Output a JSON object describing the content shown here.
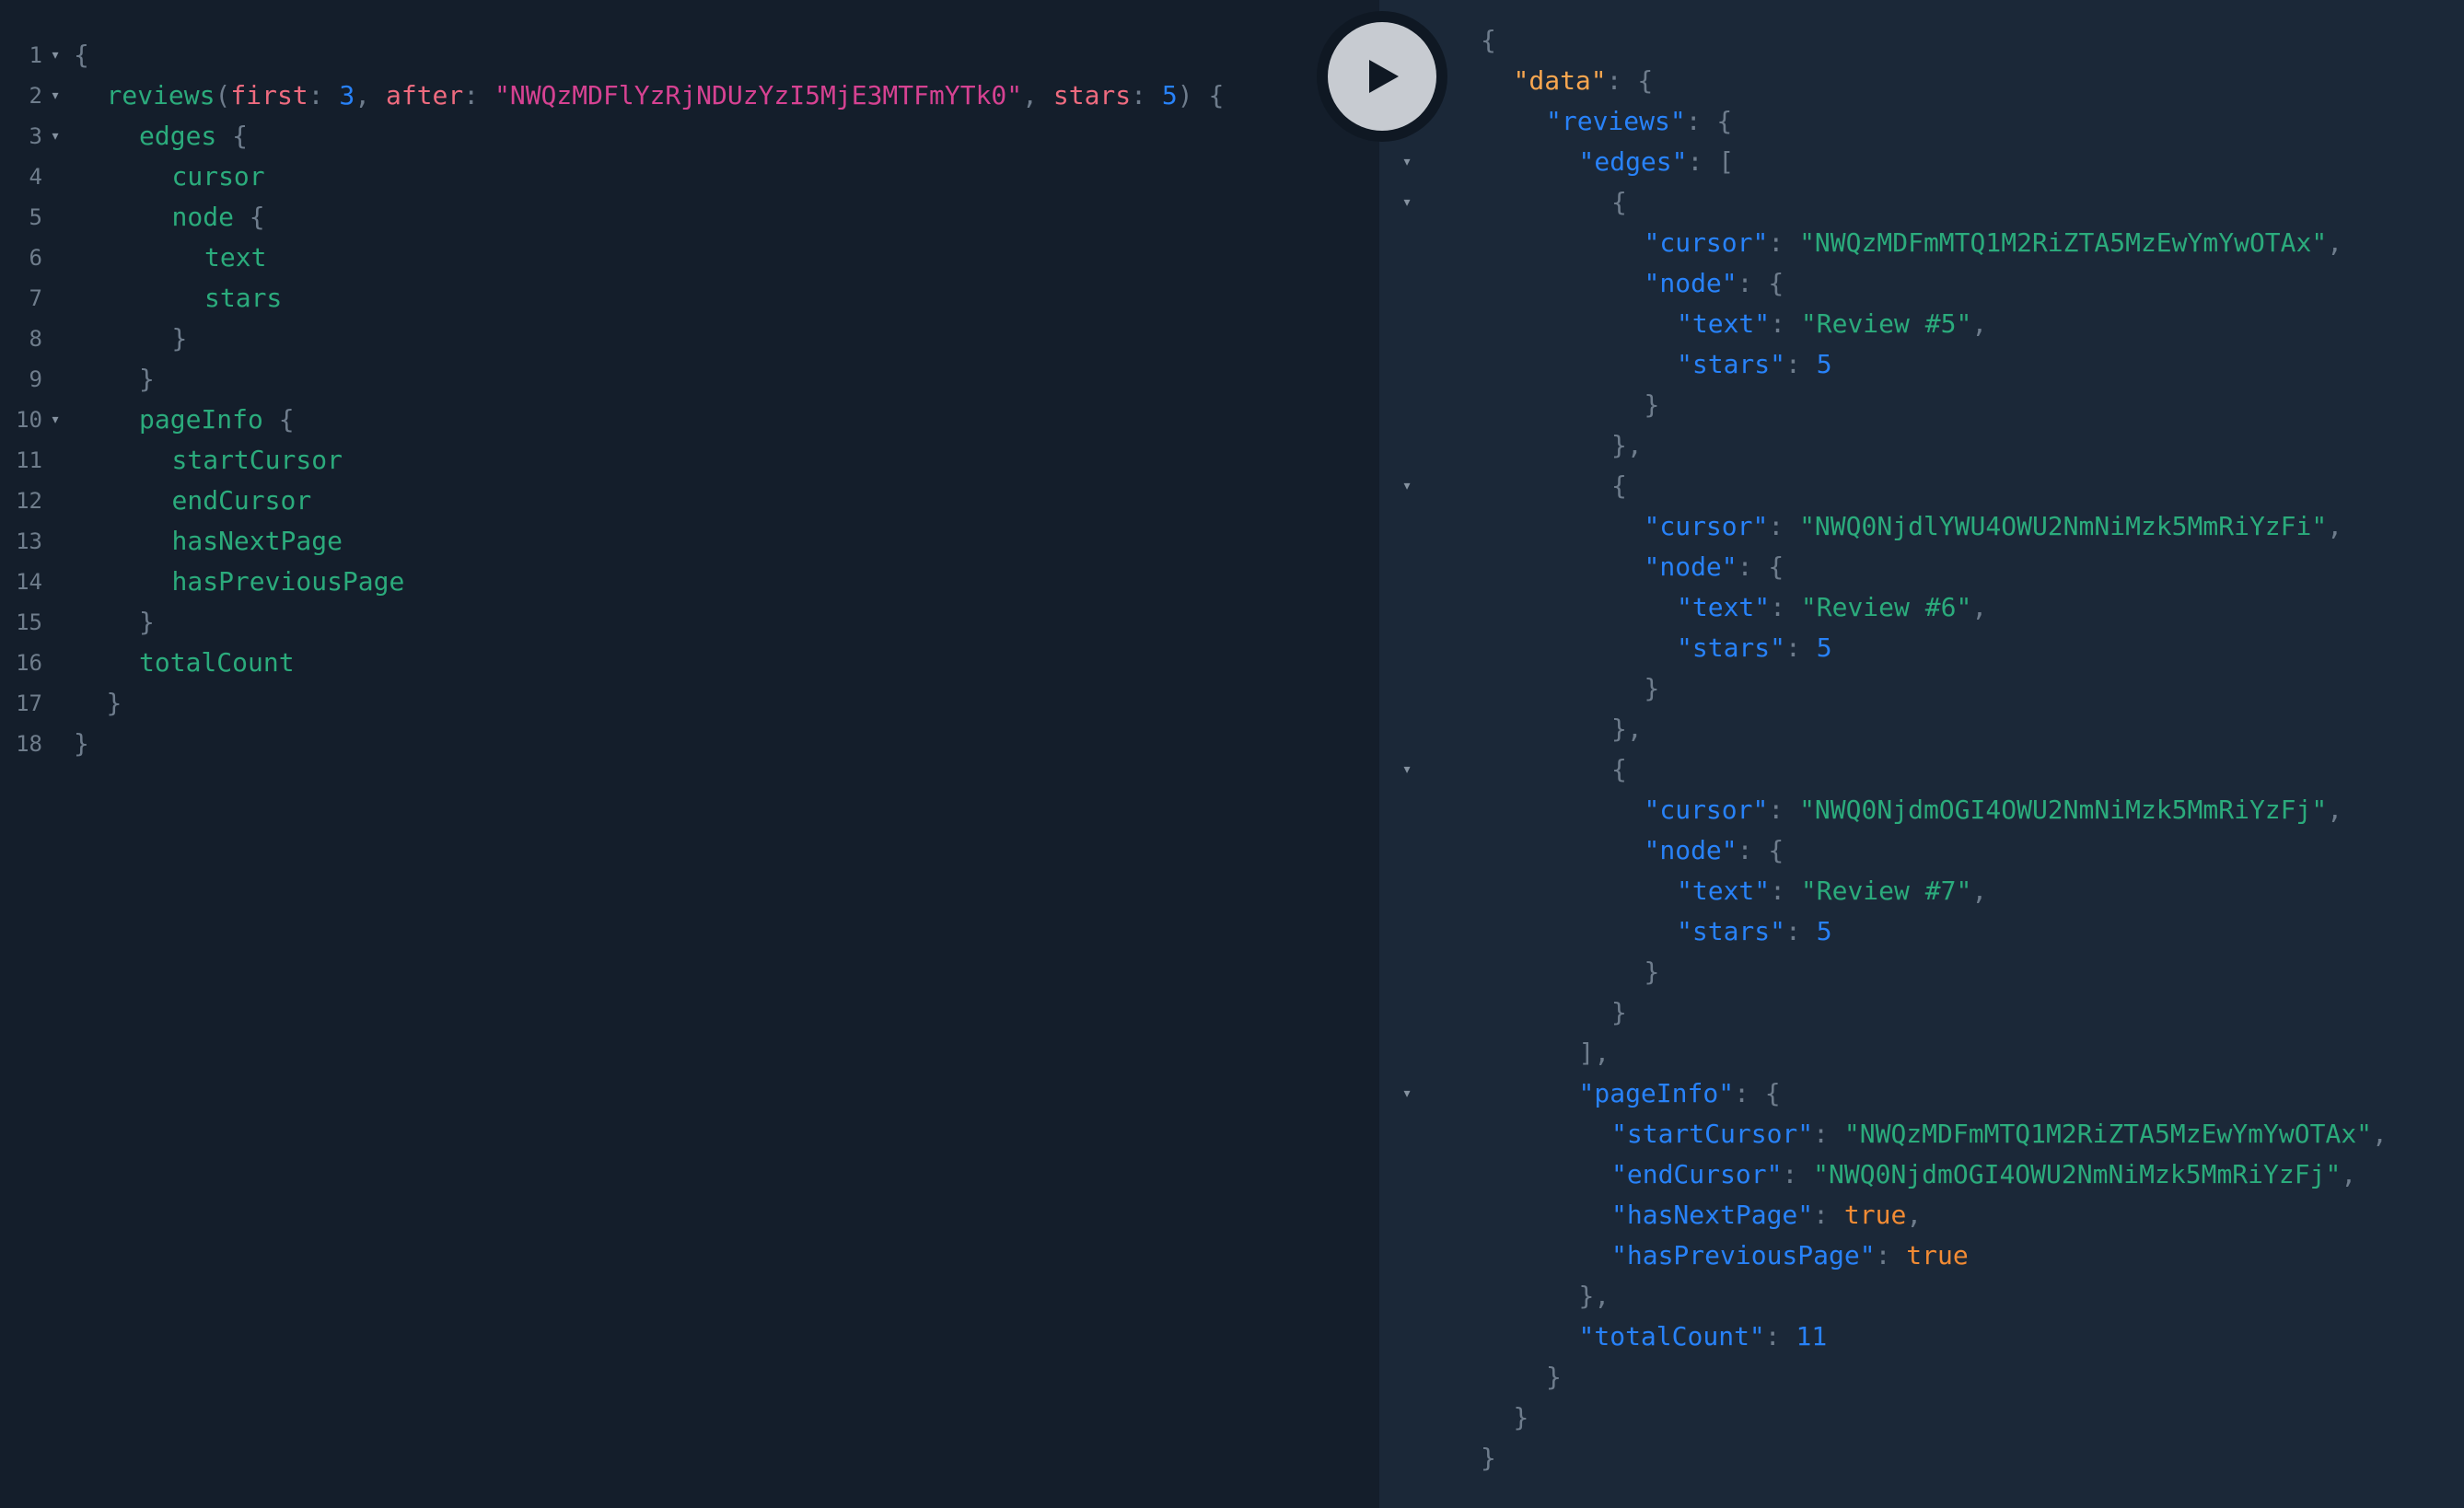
{
  "query_editor": {
    "lines": [
      {
        "n": "1",
        "fold": true,
        "indent": 0,
        "tokens": [
          {
            "c": "t-punct",
            "t": "{"
          }
        ]
      },
      {
        "n": "2",
        "fold": true,
        "indent": 1,
        "tokens": [
          {
            "c": "t-field",
            "t": "reviews"
          },
          {
            "c": "t-punct",
            "t": "("
          },
          {
            "c": "t-arg",
            "t": "first"
          },
          {
            "c": "t-punct",
            "t": ": "
          },
          {
            "c": "t-num",
            "t": "3"
          },
          {
            "c": "t-punct",
            "t": ", "
          },
          {
            "c": "t-arg",
            "t": "after"
          },
          {
            "c": "t-punct",
            "t": ": "
          },
          {
            "c": "t-str",
            "t": "\"NWQzMDFlYzRjNDUzYzI5MjE3MTFmYTk0\""
          },
          {
            "c": "t-punct",
            "t": ", "
          },
          {
            "c": "t-arg",
            "t": "stars"
          },
          {
            "c": "t-punct",
            "t": ": "
          },
          {
            "c": "t-num",
            "t": "5"
          },
          {
            "c": "t-punct",
            "t": ") {"
          }
        ]
      },
      {
        "n": "3",
        "fold": true,
        "indent": 2,
        "tokens": [
          {
            "c": "t-field",
            "t": "edges"
          },
          {
            "c": "t-punct",
            "t": " {"
          }
        ]
      },
      {
        "n": "4",
        "fold": false,
        "indent": 3,
        "tokens": [
          {
            "c": "t-field",
            "t": "cursor"
          }
        ]
      },
      {
        "n": "5",
        "fold": false,
        "indent": 3,
        "tokens": [
          {
            "c": "t-field",
            "t": "node"
          },
          {
            "c": "t-punct",
            "t": " {"
          }
        ]
      },
      {
        "n": "6",
        "fold": false,
        "indent": 4,
        "tokens": [
          {
            "c": "t-field",
            "t": "text"
          }
        ]
      },
      {
        "n": "7",
        "fold": false,
        "indent": 4,
        "tokens": [
          {
            "c": "t-field",
            "t": "stars"
          }
        ]
      },
      {
        "n": "8",
        "fold": false,
        "indent": 3,
        "tokens": [
          {
            "c": "t-punct",
            "t": "}"
          }
        ]
      },
      {
        "n": "9",
        "fold": false,
        "indent": 2,
        "tokens": [
          {
            "c": "t-punct",
            "t": "}"
          }
        ]
      },
      {
        "n": "10",
        "fold": true,
        "indent": 2,
        "tokens": [
          {
            "c": "t-field",
            "t": "pageInfo"
          },
          {
            "c": "t-punct",
            "t": " {"
          }
        ]
      },
      {
        "n": "11",
        "fold": false,
        "indent": 3,
        "tokens": [
          {
            "c": "t-field",
            "t": "startCursor"
          }
        ]
      },
      {
        "n": "12",
        "fold": false,
        "indent": 3,
        "tokens": [
          {
            "c": "t-field",
            "t": "endCursor"
          }
        ]
      },
      {
        "n": "13",
        "fold": false,
        "indent": 3,
        "tokens": [
          {
            "c": "t-field",
            "t": "hasNextPage"
          }
        ]
      },
      {
        "n": "14",
        "fold": false,
        "indent": 3,
        "tokens": [
          {
            "c": "t-field",
            "t": "hasPreviousPage"
          }
        ]
      },
      {
        "n": "15",
        "fold": false,
        "indent": 2,
        "tokens": [
          {
            "c": "t-punct",
            "t": "}"
          }
        ]
      },
      {
        "n": "16",
        "fold": false,
        "indent": 2,
        "tokens": [
          {
            "c": "t-field",
            "t": "totalCount"
          }
        ]
      },
      {
        "n": "17",
        "fold": false,
        "indent": 1,
        "tokens": [
          {
            "c": "t-punct",
            "t": "}"
          }
        ]
      },
      {
        "n": "18",
        "fold": false,
        "indent": 0,
        "tokens": [
          {
            "c": "t-punct",
            "t": "}"
          }
        ]
      }
    ]
  },
  "run_button": {
    "icon": "play-icon"
  },
  "result_viewer": {
    "lines": [
      {
        "fold": true,
        "indent": 0,
        "tokens": [
          {
            "c": "t-punct",
            "t": "{"
          }
        ]
      },
      {
        "fold": true,
        "indent": 1,
        "tokens": [
          {
            "c": "t-data",
            "t": "\"data\""
          },
          {
            "c": "t-punct",
            "t": ": {"
          }
        ]
      },
      {
        "fold": true,
        "indent": 2,
        "tokens": [
          {
            "c": "t-key",
            "t": "\"reviews\""
          },
          {
            "c": "t-punct",
            "t": ": {"
          }
        ]
      },
      {
        "fold": true,
        "indent": 3,
        "tokens": [
          {
            "c": "t-key",
            "t": "\"edges\""
          },
          {
            "c": "t-punct",
            "t": ": ["
          }
        ]
      },
      {
        "fold": true,
        "indent": 4,
        "tokens": [
          {
            "c": "t-punct",
            "t": "{"
          }
        ]
      },
      {
        "fold": false,
        "indent": 5,
        "tokens": [
          {
            "c": "t-key",
            "t": "\"cursor\""
          },
          {
            "c": "t-punct",
            "t": ": "
          },
          {
            "c": "t-rstr",
            "t": "\"NWQzMDFmMTQ1M2RiZTA5MzEwYmYwOTAx\""
          },
          {
            "c": "t-punct",
            "t": ","
          }
        ]
      },
      {
        "fold": false,
        "indent": 5,
        "tokens": [
          {
            "c": "t-key",
            "t": "\"node\""
          },
          {
            "c": "t-punct",
            "t": ": {"
          }
        ]
      },
      {
        "fold": false,
        "indent": 6,
        "tokens": [
          {
            "c": "t-key",
            "t": "\"text\""
          },
          {
            "c": "t-punct",
            "t": ": "
          },
          {
            "c": "t-rstr",
            "t": "\"Review #5\""
          },
          {
            "c": "t-punct",
            "t": ","
          }
        ]
      },
      {
        "fold": false,
        "indent": 6,
        "tokens": [
          {
            "c": "t-key",
            "t": "\"stars\""
          },
          {
            "c": "t-punct",
            "t": ": "
          },
          {
            "c": "t-num",
            "t": "5"
          }
        ]
      },
      {
        "fold": false,
        "indent": 5,
        "tokens": [
          {
            "c": "t-punct",
            "t": "}"
          }
        ]
      },
      {
        "fold": false,
        "indent": 4,
        "tokens": [
          {
            "c": "t-punct",
            "t": "},"
          }
        ]
      },
      {
        "fold": true,
        "indent": 4,
        "tokens": [
          {
            "c": "t-punct",
            "t": "{"
          }
        ]
      },
      {
        "fold": false,
        "indent": 5,
        "tokens": [
          {
            "c": "t-key",
            "t": "\"cursor\""
          },
          {
            "c": "t-punct",
            "t": ": "
          },
          {
            "c": "t-rstr",
            "t": "\"NWQ0NjdlYWU4OWU2NmNiMzk5MmRiYzFi\""
          },
          {
            "c": "t-punct",
            "t": ","
          }
        ]
      },
      {
        "fold": false,
        "indent": 5,
        "tokens": [
          {
            "c": "t-key",
            "t": "\"node\""
          },
          {
            "c": "t-punct",
            "t": ": {"
          }
        ]
      },
      {
        "fold": false,
        "indent": 6,
        "tokens": [
          {
            "c": "t-key",
            "t": "\"text\""
          },
          {
            "c": "t-punct",
            "t": ": "
          },
          {
            "c": "t-rstr",
            "t": "\"Review #6\""
          },
          {
            "c": "t-punct",
            "t": ","
          }
        ]
      },
      {
        "fold": false,
        "indent": 6,
        "tokens": [
          {
            "c": "t-key",
            "t": "\"stars\""
          },
          {
            "c": "t-punct",
            "t": ": "
          },
          {
            "c": "t-num",
            "t": "5"
          }
        ]
      },
      {
        "fold": false,
        "indent": 5,
        "tokens": [
          {
            "c": "t-punct",
            "t": "}"
          }
        ]
      },
      {
        "fold": false,
        "indent": 4,
        "tokens": [
          {
            "c": "t-punct",
            "t": "},"
          }
        ]
      },
      {
        "fold": true,
        "indent": 4,
        "tokens": [
          {
            "c": "t-punct",
            "t": "{"
          }
        ]
      },
      {
        "fold": false,
        "indent": 5,
        "tokens": [
          {
            "c": "t-key",
            "t": "\"cursor\""
          },
          {
            "c": "t-punct",
            "t": ": "
          },
          {
            "c": "t-rstr",
            "t": "\"NWQ0NjdmOGI4OWU2NmNiMzk5MmRiYzFj\""
          },
          {
            "c": "t-punct",
            "t": ","
          }
        ]
      },
      {
        "fold": false,
        "indent": 5,
        "tokens": [
          {
            "c": "t-key",
            "t": "\"node\""
          },
          {
            "c": "t-punct",
            "t": ": {"
          }
        ]
      },
      {
        "fold": false,
        "indent": 6,
        "tokens": [
          {
            "c": "t-key",
            "t": "\"text\""
          },
          {
            "c": "t-punct",
            "t": ": "
          },
          {
            "c": "t-rstr",
            "t": "\"Review #7\""
          },
          {
            "c": "t-punct",
            "t": ","
          }
        ]
      },
      {
        "fold": false,
        "indent": 6,
        "tokens": [
          {
            "c": "t-key",
            "t": "\"stars\""
          },
          {
            "c": "t-punct",
            "t": ": "
          },
          {
            "c": "t-num",
            "t": "5"
          }
        ]
      },
      {
        "fold": false,
        "indent": 5,
        "tokens": [
          {
            "c": "t-punct",
            "t": "}"
          }
        ]
      },
      {
        "fold": false,
        "indent": 4,
        "tokens": [
          {
            "c": "t-punct",
            "t": "}"
          }
        ]
      },
      {
        "fold": false,
        "indent": 3,
        "tokens": [
          {
            "c": "t-punct",
            "t": "],"
          }
        ]
      },
      {
        "fold": true,
        "indent": 3,
        "tokens": [
          {
            "c": "t-key",
            "t": "\"pageInfo\""
          },
          {
            "c": "t-punct",
            "t": ": {"
          }
        ]
      },
      {
        "fold": false,
        "indent": 4,
        "tokens": [
          {
            "c": "t-key",
            "t": "\"startCursor\""
          },
          {
            "c": "t-punct",
            "t": ": "
          },
          {
            "c": "t-rstr",
            "t": "\"NWQzMDFmMTQ1M2RiZTA5MzEwYmYwOTAx\""
          },
          {
            "c": "t-punct",
            "t": ","
          }
        ]
      },
      {
        "fold": false,
        "indent": 4,
        "tokens": [
          {
            "c": "t-key",
            "t": "\"endCursor\""
          },
          {
            "c": "t-punct",
            "t": ": "
          },
          {
            "c": "t-rstr",
            "t": "\"NWQ0NjdmOGI4OWU2NmNiMzk5MmRiYzFj\""
          },
          {
            "c": "t-punct",
            "t": ","
          }
        ]
      },
      {
        "fold": false,
        "indent": 4,
        "tokens": [
          {
            "c": "t-key",
            "t": "\"hasNextPage\""
          },
          {
            "c": "t-punct",
            "t": ": "
          },
          {
            "c": "t-bool",
            "t": "true"
          },
          {
            "c": "t-punct",
            "t": ","
          }
        ]
      },
      {
        "fold": false,
        "indent": 4,
        "tokens": [
          {
            "c": "t-key",
            "t": "\"hasPreviousPage\""
          },
          {
            "c": "t-punct",
            "t": ": "
          },
          {
            "c": "t-bool",
            "t": "true"
          }
        ]
      },
      {
        "fold": false,
        "indent": 3,
        "tokens": [
          {
            "c": "t-punct",
            "t": "},"
          }
        ]
      },
      {
        "fold": false,
        "indent": 3,
        "tokens": [
          {
            "c": "t-key",
            "t": "\"totalCount\""
          },
          {
            "c": "t-punct",
            "t": ": "
          },
          {
            "c": "t-num",
            "t": "11"
          }
        ]
      },
      {
        "fold": false,
        "indent": 2,
        "tokens": [
          {
            "c": "t-punct",
            "t": "}"
          }
        ]
      },
      {
        "fold": false,
        "indent": 1,
        "tokens": [
          {
            "c": "t-punct",
            "t": "}"
          }
        ]
      },
      {
        "fold": false,
        "indent": 0,
        "tokens": [
          {
            "c": "t-punct",
            "t": "}"
          }
        ]
      }
    ]
  },
  "fold_arrow": "▾"
}
